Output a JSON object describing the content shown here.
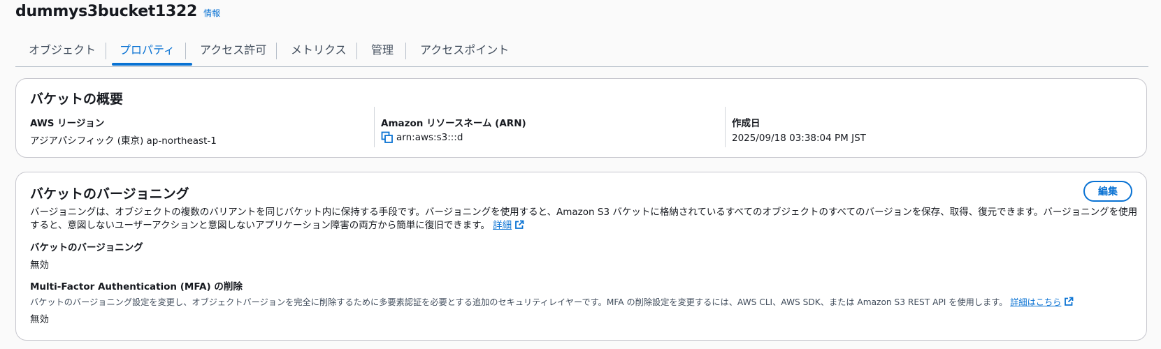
{
  "header": {
    "bucket_name": "dummys3bucket1322",
    "info_link": "情報"
  },
  "tabs": [
    {
      "label": "オブジェクト"
    },
    {
      "label": "プロパティ",
      "active": true
    },
    {
      "label": "アクセス許可"
    },
    {
      "label": "メトリクス"
    },
    {
      "label": "管理"
    },
    {
      "label": "アクセスポイント"
    }
  ],
  "overview": {
    "title": "バケットの概要",
    "region_label": "AWS リージョン",
    "region_value": "アジアパシフィック (東京) ap-northeast-1",
    "arn_label": "Amazon リソースネーム (ARN)",
    "arn_value": "arn:aws:s3:::d",
    "created_label": "作成日",
    "created_value": "2025/09/18 03:38:04 PM JST"
  },
  "versioning": {
    "title": "バケットのバージョニング",
    "edit_label": "編集",
    "description": "バージョニングは、オブジェクトの複数のバリアントを同じバケット内に保持する手段です。バージョニングを使用すると、Amazon S3 バケットに格納されているすべてのオブジェクトのすべてのバージョンを保存、取得、復元できます。バージョニングを使用すると、意図しないユーザーアクションと意図しないアプリケーション障害の両方から簡単に復旧できます。",
    "learn_more": "詳細",
    "status_label": "バケットのバージョニング",
    "status_value": "無効",
    "mfa_label": "Multi-Factor Authentication (MFA) の削除",
    "mfa_description": "バケットのバージョニング設定を変更し、オブジェクトバージョンを完全に削除するために多要素認証を必要とする追加のセキュリティレイヤーです。MFA の削除設定を変更するには、AWS CLI、AWS SDK、または Amazon S3 REST API を使用します。",
    "mfa_learn_more": "詳細はこちら",
    "mfa_value": "無効"
  },
  "colors": {
    "accent": "#0972d3",
    "text": "#16191f",
    "border": "#c6c6cd"
  }
}
